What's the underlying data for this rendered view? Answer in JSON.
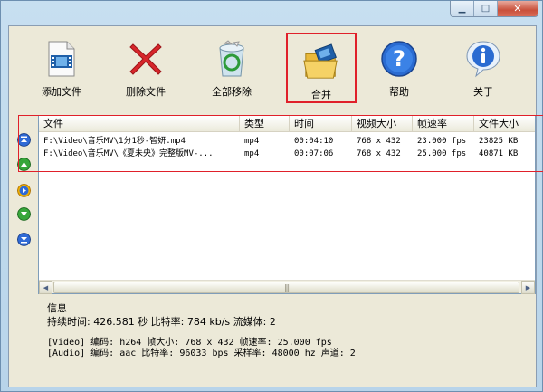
{
  "window": {
    "controls": {
      "minimize": "▁",
      "maximize": "□",
      "close": "✕"
    }
  },
  "toolbar": {
    "buttons": [
      {
        "label": "添加文件",
        "icon": "film-add-icon"
      },
      {
        "label": "删除文件",
        "icon": "red-x-icon"
      },
      {
        "label": "全部移除",
        "icon": "recycle-bin-icon"
      },
      {
        "label": "合并",
        "icon": "folder-film-icon",
        "highlighted": true
      },
      {
        "label": "帮助",
        "icon": "help-icon"
      },
      {
        "label": "关于",
        "icon": "info-icon"
      }
    ]
  },
  "side_icons": [
    "move-top-icon",
    "move-up-icon",
    "play-icon",
    "move-down-icon",
    "move-bottom-icon"
  ],
  "list": {
    "columns": [
      "文件",
      "类型",
      "时间",
      "视频大小",
      "帧速率",
      "文件大小"
    ],
    "rows": [
      [
        "F:\\Video\\音乐MV\\1分1秒-智妍.mp4",
        "mp4",
        "00:04:10",
        "768 x 432",
        "23.000 fps",
        "23825 KB"
      ],
      [
        "F:\\Video\\音乐MV\\《夏未央》完整版MV-...",
        "mp4",
        "00:07:06",
        "768 x 432",
        "25.000 fps",
        "40871 KB"
      ]
    ],
    "scroll_grip": "|||"
  },
  "info": {
    "title": "信息",
    "summary": "持续时间: 426.581 秒  比特率: 784 kb/s  流媒体: 2",
    "video": "[Video]  编码: h264  帧大小: 768 x 432  帧速率: 25.000 fps",
    "audio": "[Audio]  编码: aac  比特率: 96033 bps  采样率: 48000 hz  声道: 2"
  },
  "colors": {
    "highlight": "#e0202a",
    "panel": "#ece9d8",
    "frame": "#b8d4ea"
  }
}
